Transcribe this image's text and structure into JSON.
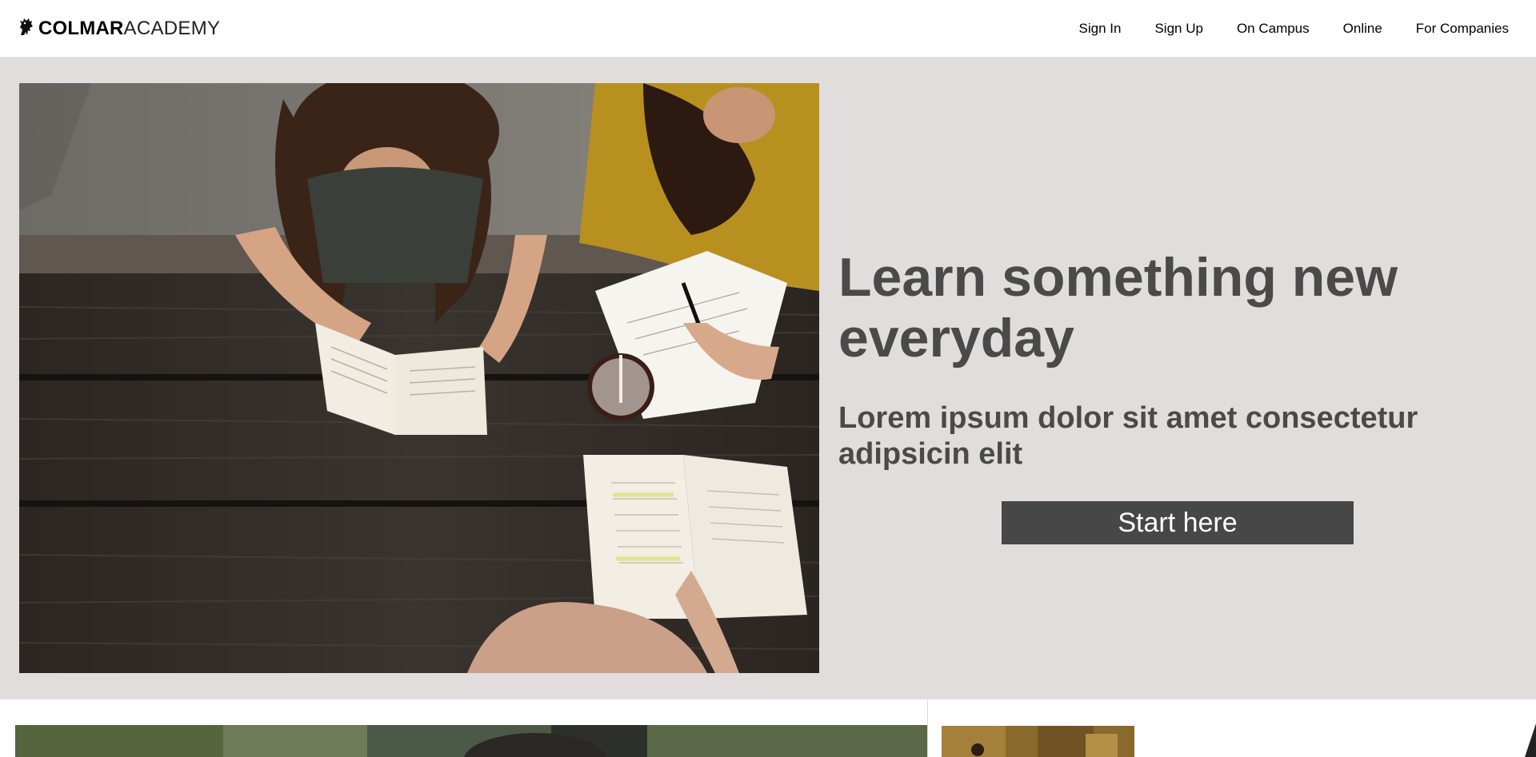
{
  "header": {
    "logo_bold": "COLMAR",
    "logo_light": "ACADEMY",
    "logo_icon": "griffin-icon",
    "nav": [
      {
        "label": "Sign In"
      },
      {
        "label": "Sign Up"
      },
      {
        "label": "On Campus"
      },
      {
        "label": "Online"
      },
      {
        "label": "For Companies"
      }
    ]
  },
  "hero": {
    "title": "Learn something new everyday",
    "subtitle": "Lorem ipsum dolor sit amet consectetur adipsicin elit",
    "cta_label": "Start here",
    "image": "students-studying-at-picnic-table-photo"
  },
  "colors": {
    "hero_background": "#e1dddc",
    "heading_text": "#4a4a4a",
    "button_background": "#474747",
    "button_text": "#ffffff"
  }
}
